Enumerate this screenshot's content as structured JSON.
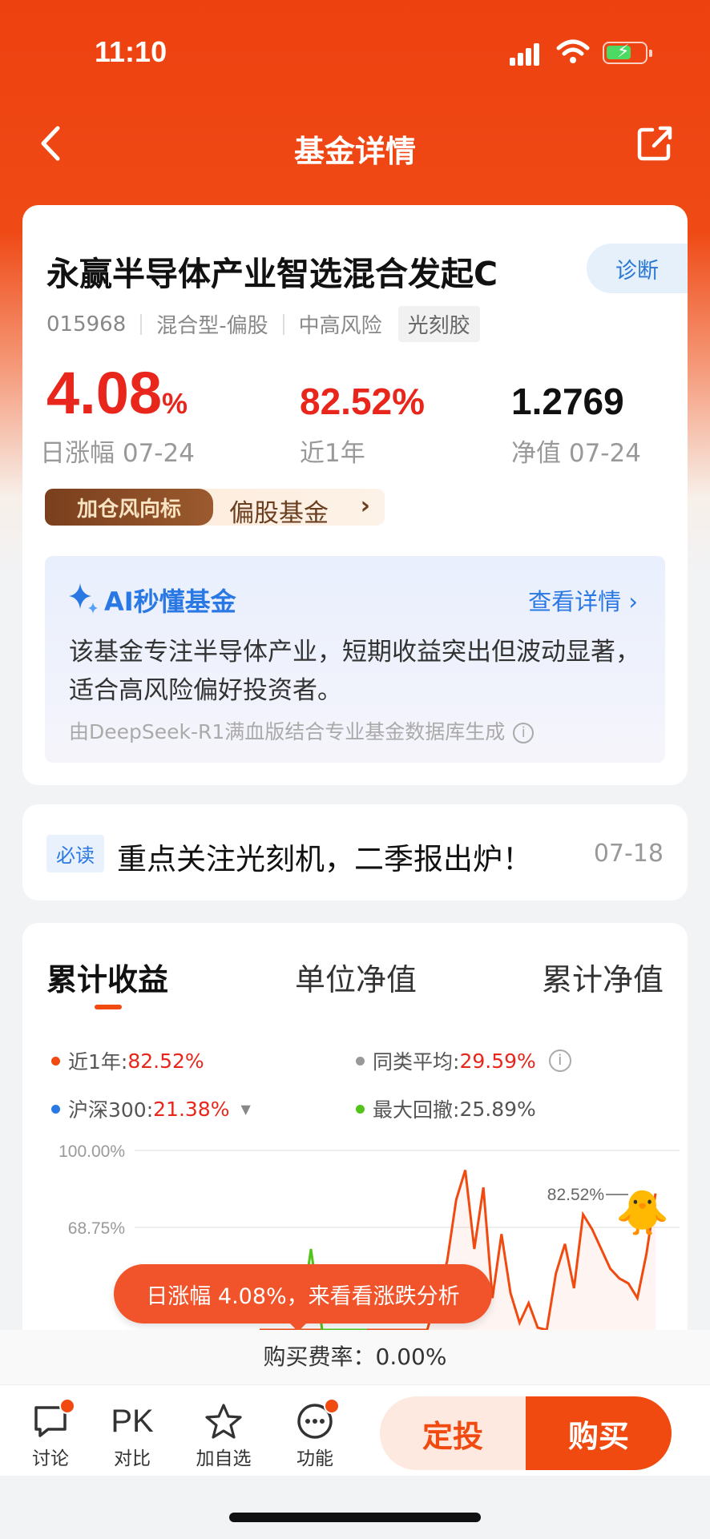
{
  "status_bar": {
    "time": "11:10"
  },
  "nav": {
    "title": "基金详情",
    "back_icon": "chevron-left-icon",
    "share_icon": "share-icon"
  },
  "fund": {
    "name": "永赢半导体产业智选混合发起C",
    "diagnose_label": "诊断",
    "code": "015968",
    "type": "混合型-偏股",
    "risk": "中高风险",
    "theme_tag": "光刻胶",
    "daily_change_value": "4.08",
    "daily_change_unit": "%",
    "daily_change_label": "日涨幅 07-24",
    "year_return": "82.52%",
    "year_return_label": "近1年",
    "nav_value": "1.2769",
    "nav_label": "净值 07-24",
    "promo_badge": "加仓风向标",
    "promo_text": "偏股基金",
    "promo_chevron": "›"
  },
  "ai_summary": {
    "title": "AI秒懂基金",
    "link": "查看详情 ›",
    "body": "该基金专注半导体产业，短期收益突出但波动显著，适合高风险偏好投资者。",
    "footnote": "由DeepSeek-R1满血版结合专业基金数据库生成"
  },
  "news": {
    "badge": "必读",
    "title": "重点关注光刻机，二季报出炉！",
    "date": "07-18"
  },
  "chart_tabs": [
    "累计收益",
    "单位净值",
    "累计净值"
  ],
  "legend": {
    "year_label": "近1年:",
    "year_value": "82.52%",
    "peer_label": "同类平均:",
    "peer_value": "29.59%",
    "hs300_label": "沪深300:",
    "hs300_value": "21.38%",
    "drawdown_label": "最大回撤:",
    "drawdown_value": "25.89%"
  },
  "chart_data": {
    "type": "line",
    "yticks": [
      "100.00%",
      "68.75%"
    ],
    "end_label": "82.52%",
    "series": [
      {
        "name": "近1年",
        "color": "#f04a10",
        "values": [
          -20,
          -26,
          -14,
          -24,
          -22,
          -18,
          -20,
          -16,
          -20,
          -14,
          -22,
          -18,
          -12,
          -16,
          -20,
          55,
          80,
          92,
          60,
          85,
          40,
          66,
          42,
          30,
          38,
          28,
          18,
          50,
          62,
          44,
          74,
          68,
          60,
          52,
          48,
          46,
          40,
          58,
          82.52
        ]
      },
      {
        "name": "同类平均",
        "color": "#999999",
        "values": []
      },
      {
        "name": "沪深300",
        "color": "#2a78e4",
        "values": []
      },
      {
        "name": "最大回撤",
        "color": "#52c41a",
        "values": [
          -12,
          60,
          -30,
          -14,
          10,
          -20,
          0
        ]
      }
    ]
  },
  "toast": {
    "text": "日涨幅 4.08%，来看看涨跌分析"
  },
  "fee": {
    "text": "购买费率：0.00%"
  },
  "bottom_nav": [
    {
      "label": "讨论",
      "icon": "chat-icon"
    },
    {
      "label": "对比",
      "icon": "pk-icon",
      "glyph": "PK"
    },
    {
      "label": "加自选",
      "icon": "star-icon"
    },
    {
      "label": "功能",
      "icon": "more-icon"
    }
  ],
  "actions": {
    "invest_label": "定投",
    "buy_label": "购买"
  },
  "colors": {
    "brand": "#f04a10",
    "up": "#e8261c",
    "link": "#2a78e4"
  }
}
